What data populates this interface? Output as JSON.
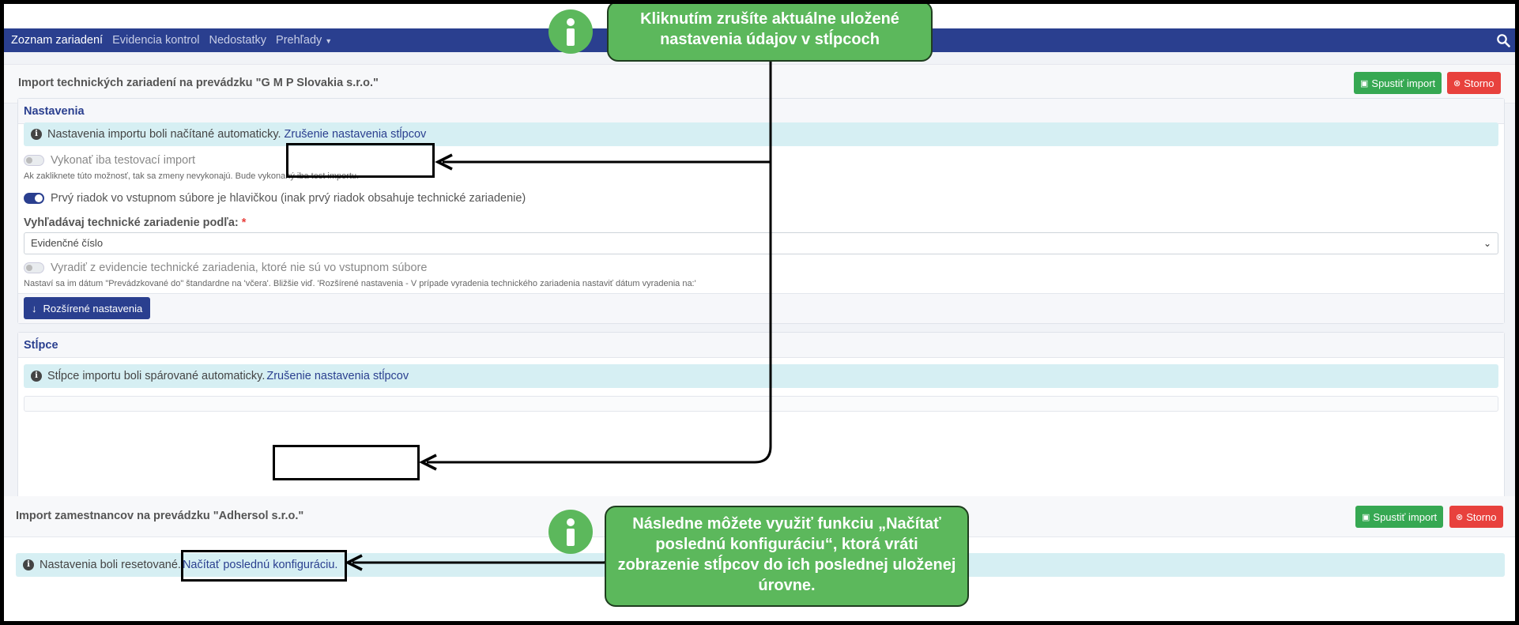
{
  "navbar": {
    "items": [
      "Zoznam zariadení",
      "Evidencia kontrol",
      "Nedostatky",
      "Prehľady"
    ]
  },
  "top_panel": {
    "title": "Import technických zariadení na prevádzku \"G M P Slovakia s.r.o.\"",
    "start_import": "Spustiť import",
    "cancel": "Storno",
    "settings_card": {
      "header": "Nastavenia",
      "alert_text": "Nastavenia importu boli načítané automaticky.",
      "alert_link": "Zrušenie nastavenia stĺpcov",
      "test_import_label": "Vykonať iba testovací import",
      "test_import_help": "Ak zakliknete túto možnosť, tak sa zmeny nevykonajú. Bude vykonaný iba test importu.",
      "header_row_label": "Prvý riadok vo vstupnom súbore je hlavičkou (inak prvý riadok obsahuje technické zariadenie)",
      "search_label": "Vyhľadávaj technické zariadenie podľa:",
      "required_mark": "*",
      "search_value": "Evidenčné číslo",
      "discard_label": "Vyradiť z evidencie technické zariadenia, ktoré nie sú vo vstupnom súbore",
      "discard_help": "Nastaví sa im dátum \"Prevádzkované do\" štandardne na 'včera'. Bližšie viď. 'Rozšírené nastavenia - V prípade vyradenia technického zariadenia nastaviť dátum vyradenia na:'",
      "advanced_button": "Rozšírené nastavenia"
    },
    "columns_card": {
      "header": "Stĺpce",
      "alert_text": "Stĺpce importu boli spárované automaticky.",
      "alert_link": "Zrušenie nastavenia stĺpcov"
    }
  },
  "bottom_panel": {
    "title": "Import zamestnancov na prevádzku \"Adhersol s.r.o.\"",
    "start_import": "Spustiť import",
    "cancel": "Storno",
    "alert_text": "Nastavenia boli resetované.",
    "alert_link": "Načítať poslednú konfiguráciu."
  },
  "callouts": {
    "top": "Kliknutím zrušíte aktuálne uložené nastavenia údajov v stĺpcoch",
    "bottom": "Následne môžete využiť funkciu „Načítať poslednú konfiguráciu“, ktorá vráti zobrazenie stĺpcov do ich poslednej uloženej úrovne."
  },
  "colors": {
    "navbar": "#2a3f8f",
    "success": "#36a852",
    "danger": "#e8413d",
    "callout": "#5cb85c",
    "alert_bg": "#d6eff3"
  }
}
